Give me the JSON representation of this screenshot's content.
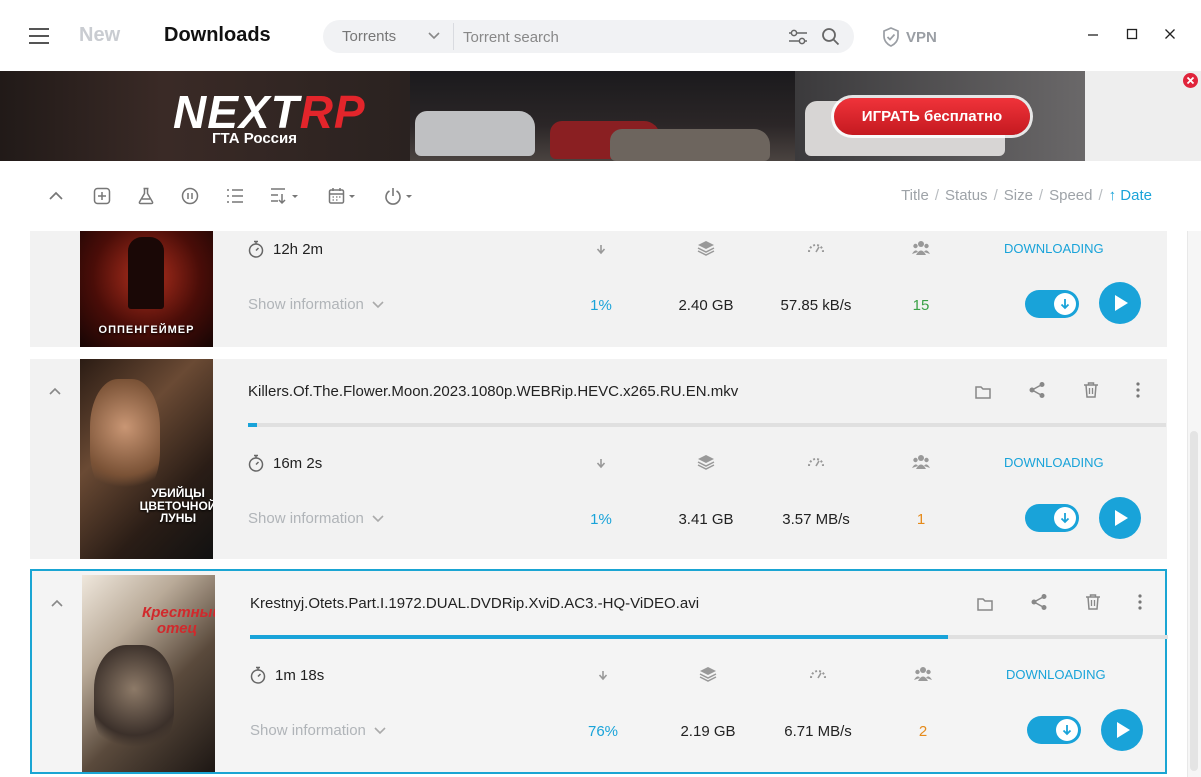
{
  "header": {
    "tab_new": "New",
    "tab_downloads": "Downloads",
    "search_category": "Torrents",
    "search_placeholder": "Torrent search",
    "vpn_label": "VPN"
  },
  "banner": {
    "logo_main": "NEXT",
    "logo_accent": "RP",
    "subtitle": "ГТА Россия",
    "cta": "ИГРАТЬ бесплатно"
  },
  "sort": {
    "title": "Title",
    "status": "Status",
    "size": "Size",
    "speed": "Speed",
    "date": "↑ Date"
  },
  "downloads": [
    {
      "filename": "",
      "poster_title": "ОППЕНГЕЙМЕР",
      "time_left": "12h 2m",
      "status": "DOWNLOADING",
      "show_info": "Show information",
      "percent": "1%",
      "progress": 0.01,
      "size": "2.40 GB",
      "speed": "57.85 kB/s",
      "peers": "15"
    },
    {
      "filename": "Killers.Of.The.Flower.Moon.2023.1080p.WEBRip.HEVC.x265.RU.EN.mkv",
      "poster_title": "УБИЙЦЫ ЦВЕТОЧНОЙ ЛУНЫ",
      "time_left": "16m 2s",
      "status": "DOWNLOADING",
      "show_info": "Show information",
      "percent": "1%",
      "progress": 0.01,
      "size": "3.41 GB",
      "speed": "3.57 MB/s",
      "peers": "1"
    },
    {
      "filename": "Krestnyj.Otets.Part.I.1972.DUAL.DVDRip.XviD.AC3.-HQ-ViDEO.avi",
      "poster_title": "Крестный отец",
      "time_left": "1m 18s",
      "status": "DOWNLOADING",
      "show_info": "Show information",
      "percent": "76%",
      "progress": 0.76,
      "size": "2.19 GB",
      "speed": "6.71 MB/s",
      "peers": "2"
    }
  ],
  "colors": {
    "accent": "#19a3d9",
    "peers_high": "#3aa146",
    "peers_low": "#e58a1a",
    "banner_cta": "#e3252b"
  }
}
